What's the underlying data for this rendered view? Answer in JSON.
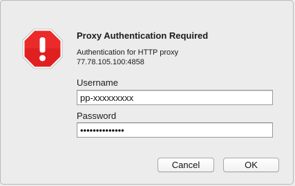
{
  "dialog": {
    "title": "Proxy Authentication Required",
    "message_line1": "Authentication for HTTP proxy",
    "message_line2": "77.78.105.100:4858",
    "icon": "warning-stop-icon"
  },
  "form": {
    "username_label": "Username",
    "username_value": "pp-xxxxxxxxx",
    "password_label": "Password",
    "password_value": "••••••••••••••"
  },
  "buttons": {
    "cancel_label": "Cancel",
    "ok_label": "OK"
  },
  "colors": {
    "warning_red": "#e02020",
    "warning_border": "#ffffff",
    "dialog_bg": "#ececec"
  }
}
